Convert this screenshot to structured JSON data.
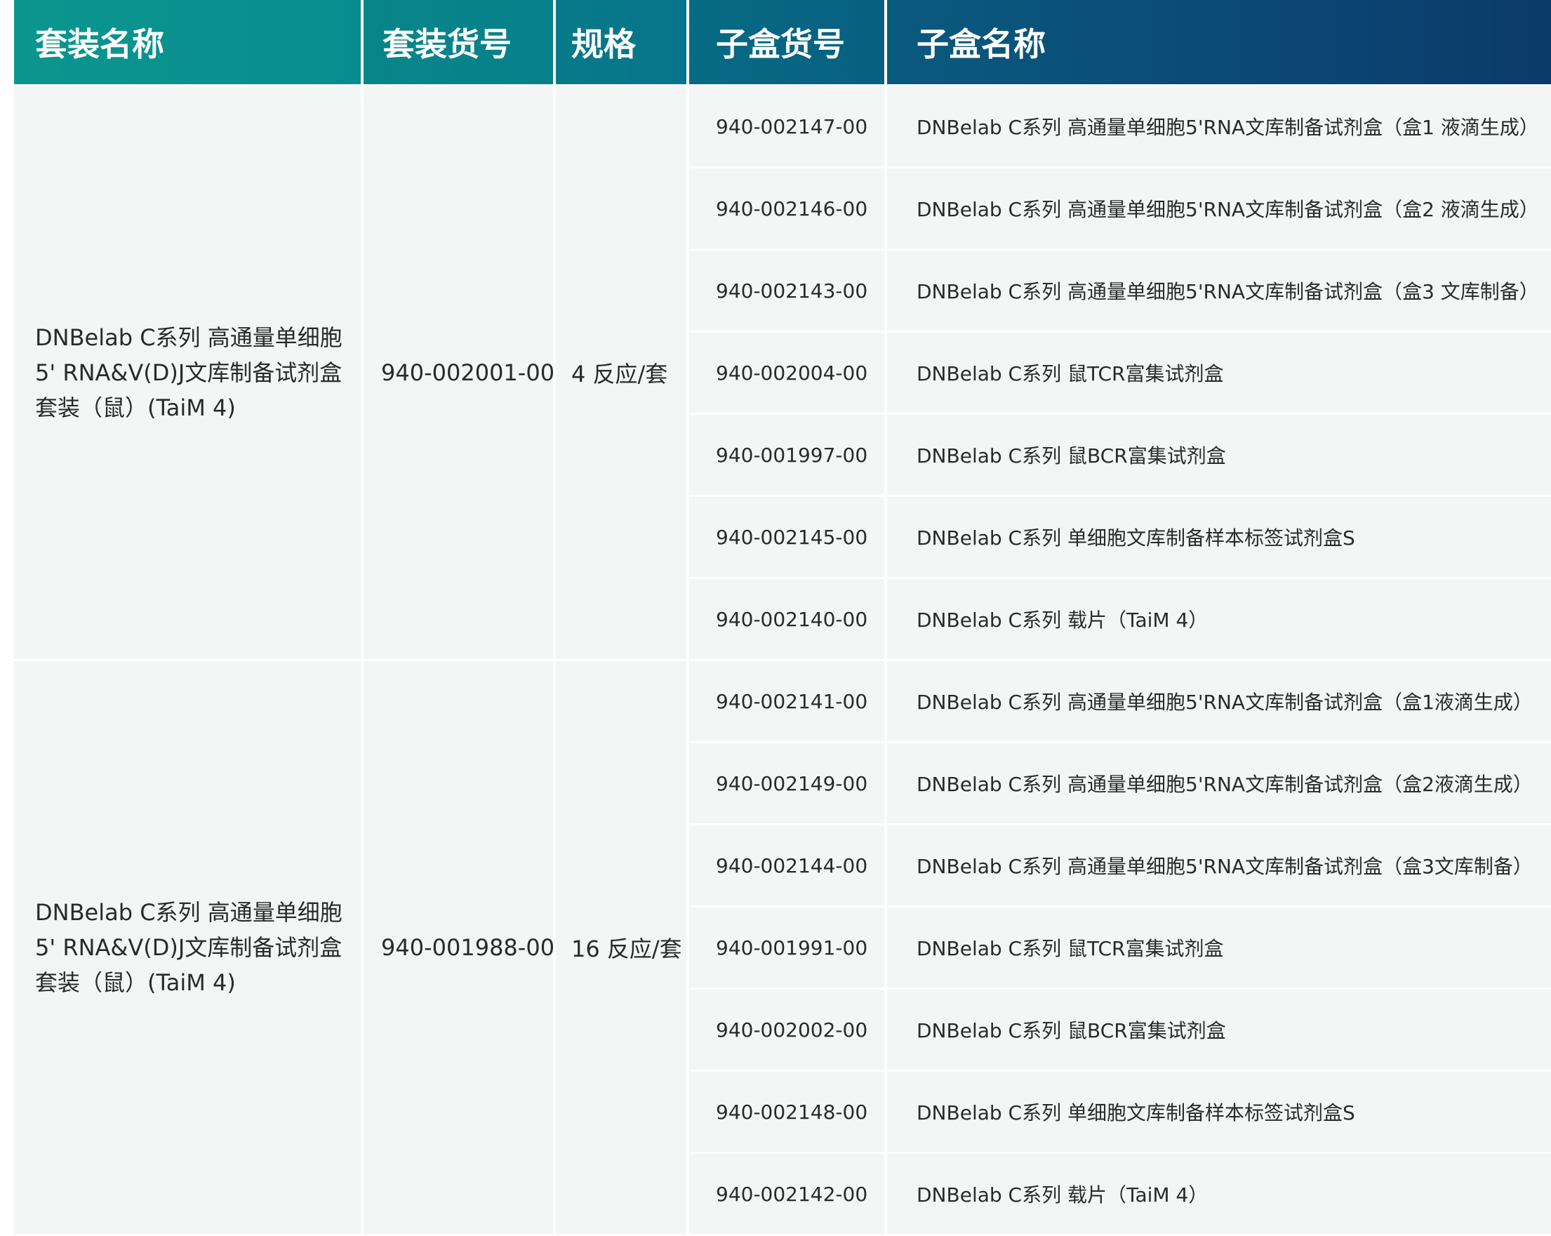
{
  "headers": {
    "kit_name": "套装名称",
    "kit_catalog": "套装货号",
    "spec": "规格",
    "sub_catalog": "子盒货号",
    "sub_name": "子盒名称"
  },
  "kits": [
    {
      "name_lines": [
        "DNBelab C系列 高通量单细胞",
        "5' RNA&V(D)J文库制备试剂盒",
        "套装（鼠）(TaiM 4)"
      ],
      "catalog": "940-002001-00",
      "spec": "4 反应/套",
      "sub_items": [
        {
          "catalog": "940-002147-00",
          "name": "DNBelab C系列 高通量单细胞5'RNA文库制备试剂盒（盒1 液滴生成）"
        },
        {
          "catalog": "940-002146-00",
          "name": "DNBelab C系列 高通量单细胞5'RNA文库制备试剂盒（盒2 液滴生成）"
        },
        {
          "catalog": "940-002143-00",
          "name": "DNBelab C系列 高通量单细胞5'RNA文库制备试剂盒（盒3 文库制备）"
        },
        {
          "catalog": "940-002004-00",
          "name": "DNBelab C系列 鼠TCR富集试剂盒"
        },
        {
          "catalog": "940-001997-00",
          "name": "DNBelab C系列 鼠BCR富集试剂盒"
        },
        {
          "catalog": "940-002145-00",
          "name": "DNBelab C系列 单细胞文库制备样本标签试剂盒S"
        },
        {
          "catalog": "940-002140-00",
          "name": "DNBelab C系列 载片（TaiM 4）"
        }
      ]
    },
    {
      "name_lines": [
        "DNBelab C系列 高通量单细胞",
        "5' RNA&V(D)J文库制备试剂盒",
        "套装（鼠）(TaiM 4)"
      ],
      "catalog": "940-001988-00",
      "spec": "16 反应/套",
      "sub_items": [
        {
          "catalog": "940-002141-00",
          "name": "DNBelab C系列 高通量单细胞5'RNA文库制备试剂盒（盒1液滴生成）"
        },
        {
          "catalog": "940-002149-00",
          "name": "DNBelab C系列 高通量单细胞5'RNA文库制备试剂盒（盒2液滴生成）"
        },
        {
          "catalog": "940-002144-00",
          "name": "DNBelab C系列 高通量单细胞5'RNA文库制备试剂盒（盒3文库制备）"
        },
        {
          "catalog": "940-001991-00",
          "name": "DNBelab C系列 鼠TCR富集试剂盒"
        },
        {
          "catalog": "940-002002-00",
          "name": "DNBelab C系列 鼠BCR富集试剂盒"
        },
        {
          "catalog": "940-002148-00",
          "name": "DNBelab C系列 单细胞文库制备样本标签试剂盒S"
        },
        {
          "catalog": "940-002142-00",
          "name": "DNBelab C系列 载片（TaiM 4）"
        }
      ]
    }
  ],
  "colors": {
    "header_start": "#0a968f",
    "header_end": "#0b3a68",
    "row_background": "#f3f6f5",
    "divider": "#ffffff",
    "text": "#2a2a2a"
  }
}
